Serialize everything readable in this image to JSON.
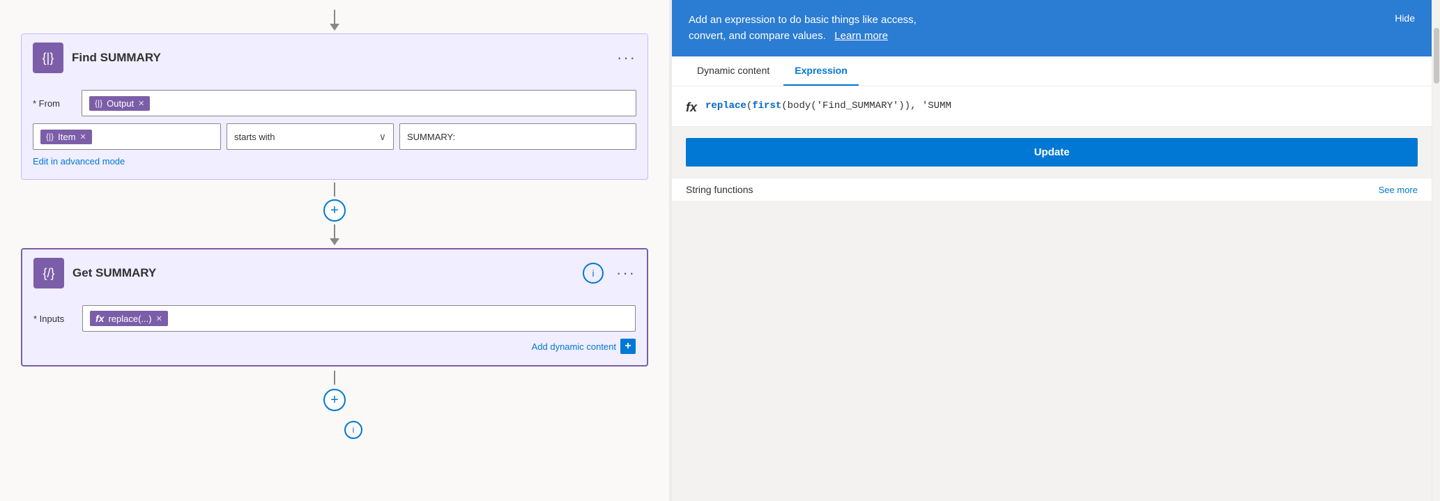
{
  "canvas": {
    "top_connector_visible": true,
    "find_summary_card": {
      "title": "Find SUMMARY",
      "icon_symbol": "{|}",
      "from_label": "* From",
      "from_token": {
        "icon": "{|}",
        "label": "Output",
        "show_close": true
      },
      "filter": {
        "field_token": {
          "icon": "{|}",
          "label": "Item",
          "show_close": true
        },
        "operator": "starts with",
        "value": "SUMMARY:"
      },
      "advanced_link": "Edit in advanced mode",
      "menu_dots": "···"
    },
    "add_btn_middle": "+",
    "get_summary_card": {
      "title": "Get SUMMARY",
      "icon_symbol": "{/}",
      "inputs_label": "* Inputs",
      "inputs_token": {
        "icon": "fx",
        "label": "replace(...)",
        "show_close": true
      },
      "dynamic_content_label": "Add dynamic content",
      "menu_dots": "···",
      "info_btn": "i"
    },
    "bottom_add_btn": "+",
    "bottom_info_btn": "i"
  },
  "expression_panel": {
    "header_text_line1": "Add an expression to do basic things like access,",
    "header_text_line2": "convert, and compare values.",
    "learn_more": "Learn more",
    "hide_label": "Hide",
    "tabs": [
      {
        "id": "dynamic",
        "label": "Dynamic content"
      },
      {
        "id": "expression",
        "label": "Expression",
        "active": true
      }
    ],
    "fx_icon": "fx",
    "expression_code": "replace(first(body('Find_SUMMARY')), 'SUMM",
    "update_btn": "Update",
    "string_functions_label": "String functions",
    "see_more_label": "See more"
  }
}
